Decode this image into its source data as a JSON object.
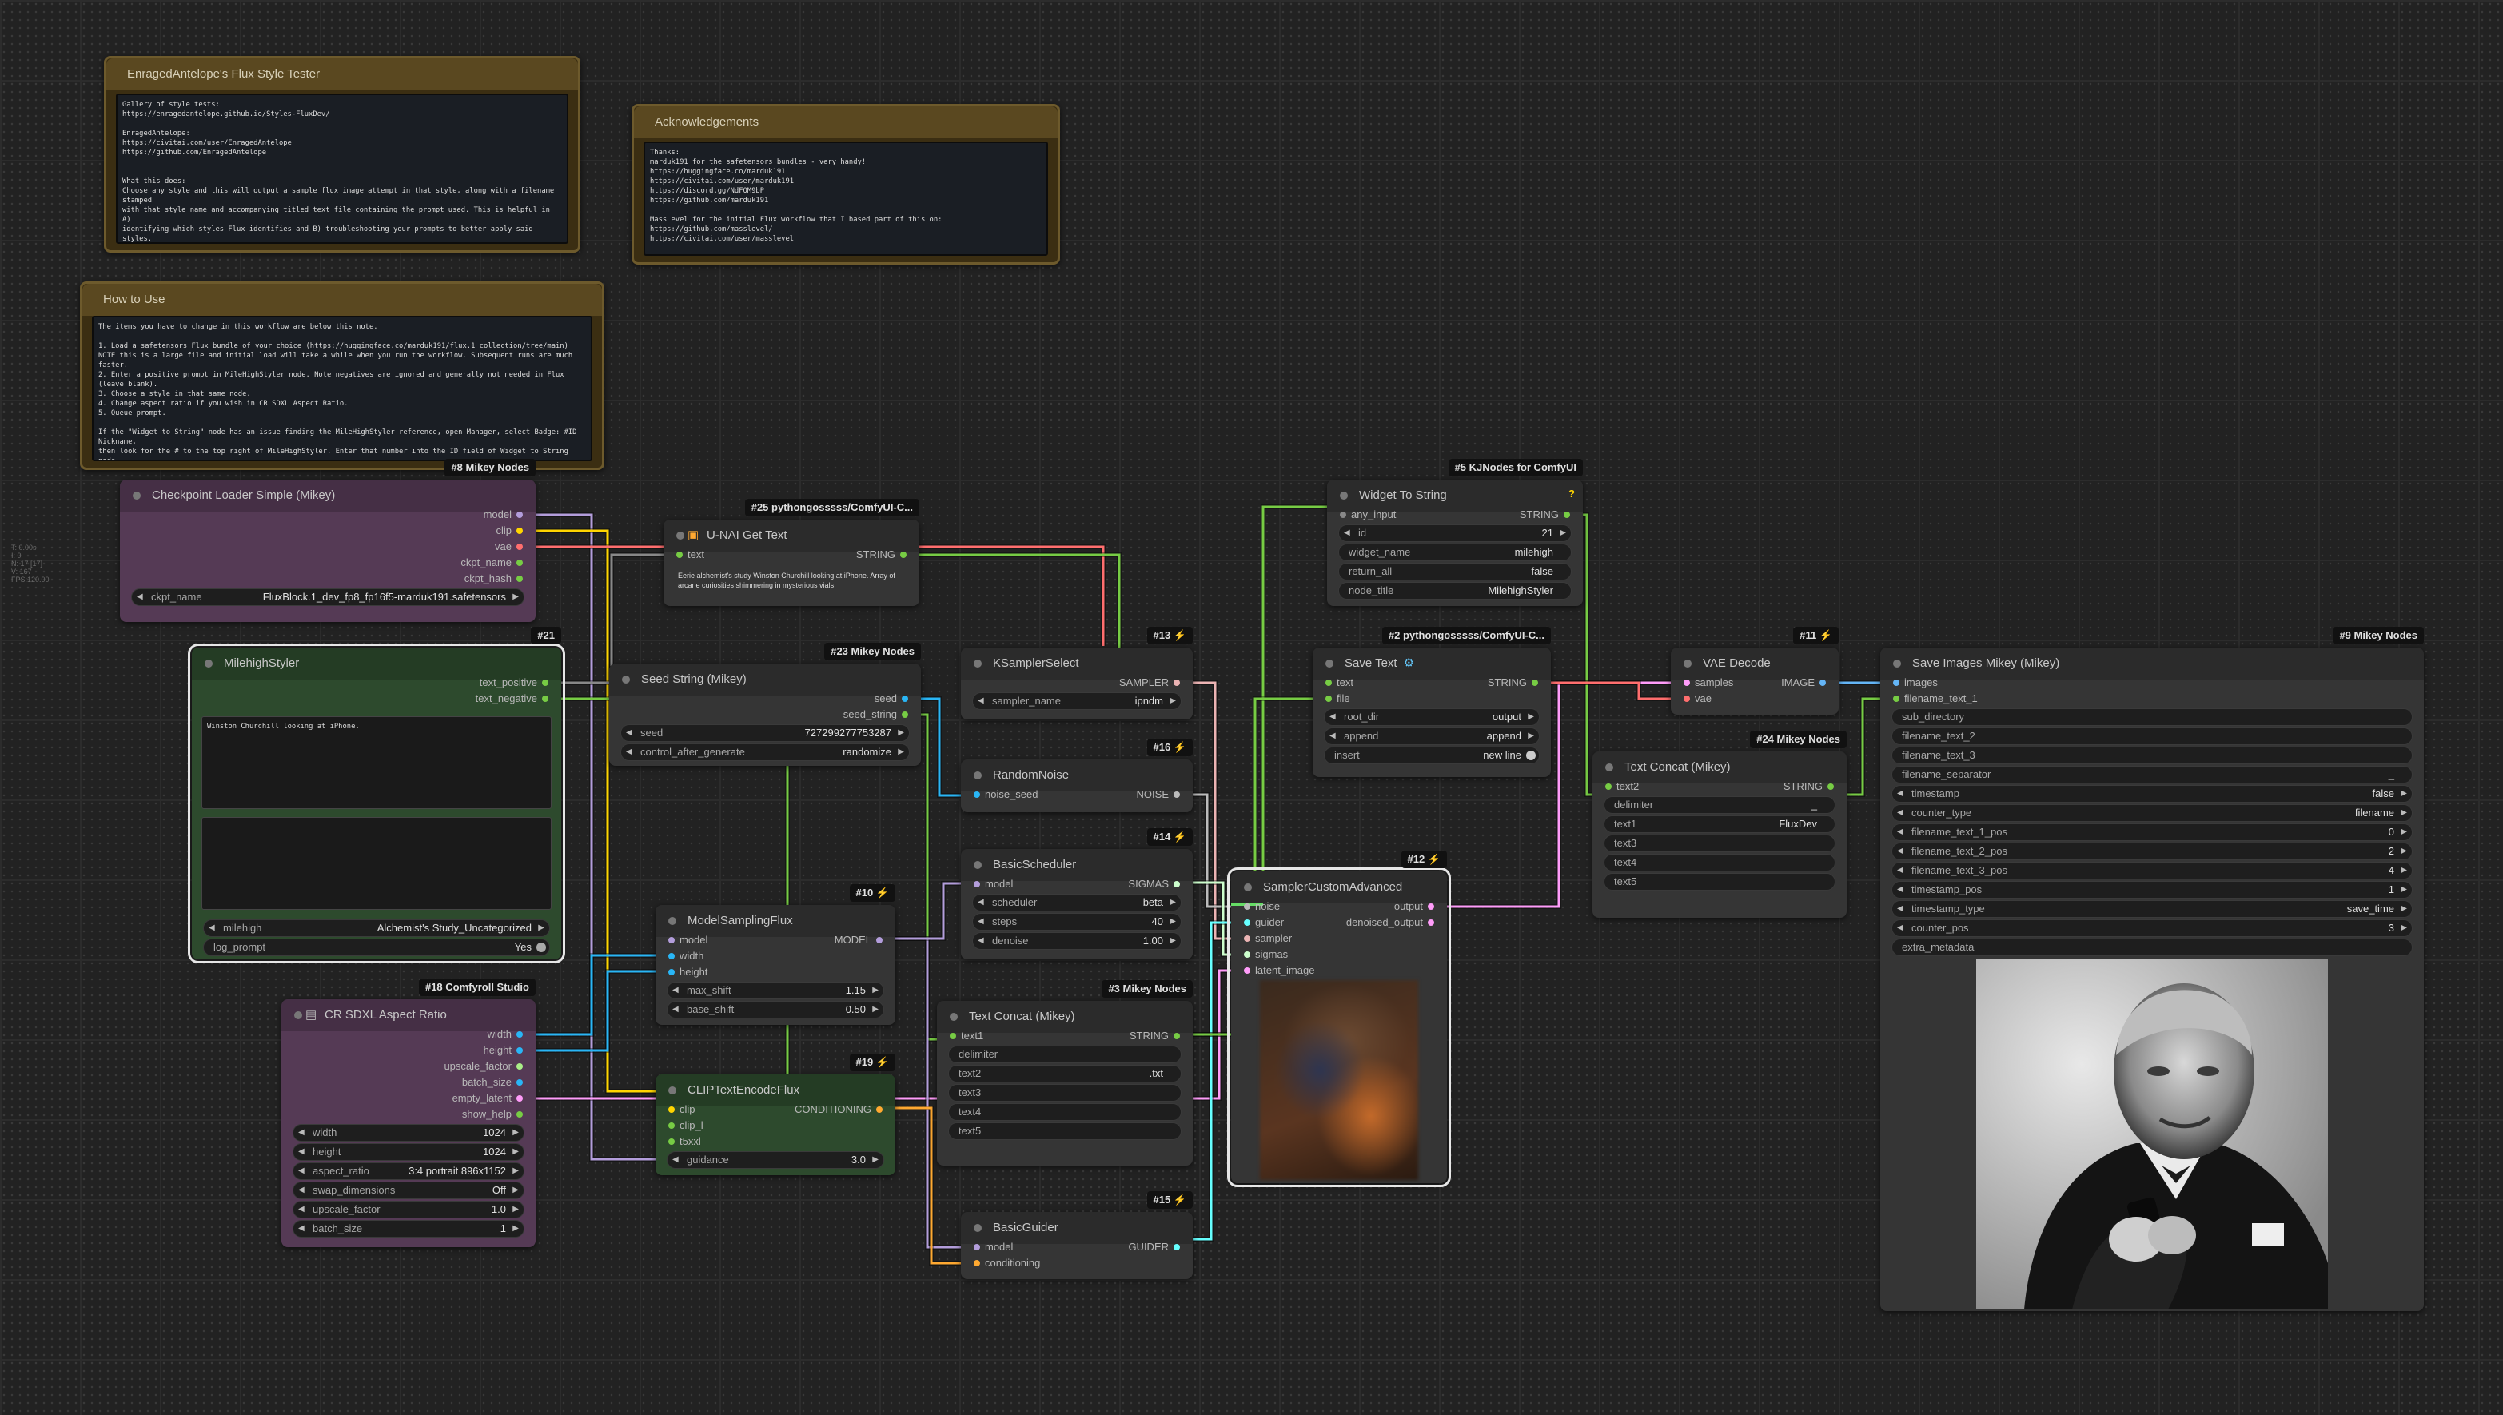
{
  "colors": {
    "model": "#b39ddb",
    "clip": "#ffd500",
    "vae": "#ff6e6e",
    "string": "#77cc44",
    "int": "#29b6f6",
    "float": "#aaee88",
    "conditioning": "#ffa931",
    "latent": "#ff9cf9",
    "image": "#64b5f6",
    "noise": "#bbbbbb",
    "sampler": "#ecb4b4",
    "sigmas": "#cdffcd",
    "guider": "#66ffff",
    "grey": "#888888"
  },
  "status_text": "T: 0.00s\nI: 0\nN: 17 [17]\nV: 167\nFPS:120.00",
  "n1": {
    "title": "EnragedAntelope's Flux Style Tester",
    "text": "Gallery of style tests:\nhttps://enragedantelope.github.io/Styles-FluxDev/\n\nEnragedAntelope:\nhttps://civitai.com/user/EnragedAntelope\nhttps://github.com/EnragedAntelope\n\n\nWhat this does:\nChoose any style and this will output a sample flux image attempt in that style, along with a filename stamped\nwith that style name and accompanying titled text file containing the prompt used. This is helpful in A)\nidentifying which styles Flux identifies and B) troubleshooting your prompts to better apply said styles."
  },
  "n2": {
    "title": "Acknowledgements",
    "text": "Thanks:\nmarduk191 for the safetensors bundles - very handy!\nhttps://huggingface.co/marduk191\nhttps://civitai.com/user/marduk191\nhttps://discord.gg/NdFQM9bP\nhttps://github.com/marduk191\n\nMassLevel for the initial Flux workflow that I based part of this on:\nhttps://github.com/masslevel/\nhttps://civitai.com/user/masslevel\n\nAs well as the Flux team, Comfy and node devs!"
  },
  "n3": {
    "title": "How to Use",
    "text": "The items you have to change in this workflow are below this note.\n\n1. Load a safetensors Flux bundle of your choice (https://huggingface.co/marduk191/flux.1_collection/tree/main)\nNOTE this is a large file and initial load will take a while when you run the workflow. Subsequent runs are much faster.\n2. Enter a positive prompt in MileHighStyler node. Note negatives are ignored and generally not needed in Flux (leave blank).\n3. Choose a style in that same node.\n4. Change aspect ratio if you wish in CR SDXL Aspect Ratio.\n5. Queue prompt.\n\nIf the \"Widget to String\" node has an issue finding the MileHighStyler reference, open Manager, select Badge: #ID Nickname,\nthen look for the # to the top right of MileHighStyler. Enter that number into the ID field of Widget to String node."
  },
  "ckpt": {
    "badge": "#8 Mikey Nodes",
    "title": "Checkpoint Loader Simple (Mikey)",
    "outputs": [
      "model",
      "clip",
      "vae",
      "ckpt_name",
      "ckpt_hash"
    ],
    "w_name": "ckpt_name",
    "w_value": "FluxBlock.1_dev_fp8_fp16f5-marduk191.safetensors"
  },
  "unai": {
    "badge": "#25 pythongosssss/ComfyUI-C...",
    "title": "U-NAI Get Text",
    "in": "text",
    "out": "STRING",
    "text": "Eerie alchemist's study Winston Churchill looking at iPhone. Array of arcane curiosities shimmering in mysterious vials"
  },
  "styler": {
    "badge": "#21",
    "title": "MilehighStyler",
    "outputs": [
      "text_positive",
      "text_negative"
    ],
    "pos": "Winston Churchill looking at iPhone.",
    "w1_name": "milehigh",
    "w1_value": "Alchemist's Study_Uncategorized",
    "w2_name": "log_prompt",
    "w2_value": "Yes"
  },
  "seed": {
    "badge": "#23 Mikey Nodes",
    "title": "Seed String (Mikey)",
    "outputs": [
      "seed",
      "seed_string"
    ],
    "w1_name": "seed",
    "w1_value": "727299277753287",
    "w2_name": "control_after_generate",
    "w2_value": "randomize"
  },
  "ksel": {
    "badge": "#13 ⚡",
    "title": "KSamplerSelect",
    "out": "SAMPLER",
    "w_name": "sampler_name",
    "w_value": "ipndm"
  },
  "noise": {
    "badge": "#16 ⚡",
    "title": "RandomNoise",
    "in": "noise_seed",
    "out": "NOISE"
  },
  "sched": {
    "badge": "#14 ⚡",
    "title": "BasicScheduler",
    "in": "model",
    "out": "SIGMAS",
    "w": [
      {
        "n": "scheduler",
        "v": "beta"
      },
      {
        "n": "steps",
        "v": "40"
      },
      {
        "n": "denoise",
        "v": "1.00"
      }
    ]
  },
  "msf": {
    "badge": "#10 ⚡",
    "title": "ModelSamplingFlux",
    "inputs": [
      "model",
      "width",
      "height"
    ],
    "out": "MODEL",
    "w": [
      {
        "n": "max_shift",
        "v": "1.15"
      },
      {
        "n": "base_shift",
        "v": "0.50"
      }
    ]
  },
  "cr": {
    "badge": "#18 Comfyroll Studio",
    "title": "CR SDXL Aspect Ratio",
    "outputs": [
      "width",
      "height",
      "upscale_factor",
      "batch_size",
      "empty_latent",
      "show_help"
    ],
    "w": [
      {
        "n": "width",
        "v": "1024"
      },
      {
        "n": "height",
        "v": "1024"
      },
      {
        "n": "aspect_ratio",
        "v": "3:4 portrait 896x1152"
      },
      {
        "n": "swap_dimensions",
        "v": "Off"
      },
      {
        "n": "upscale_factor",
        "v": "1.0"
      },
      {
        "n": "batch_size",
        "v": "1"
      }
    ]
  },
  "clipt": {
    "badge": "#19 ⚡",
    "title": "CLIPTextEncodeFlux",
    "inputs": [
      "clip",
      "clip_l",
      "t5xxl"
    ],
    "out": "CONDITIONING",
    "w_name": "guidance",
    "w_value": "3.0"
  },
  "tc3": {
    "badge": "#3 Mikey Nodes",
    "title": "Text Concat (Mikey)",
    "in": "text1",
    "out": "STRING",
    "rows": [
      "delimiter",
      "text2",
      "text3",
      "text4",
      "text5"
    ],
    "row2val": ".txt"
  },
  "bg": {
    "badge": "#15 ⚡",
    "title": "BasicGuider",
    "inputs": [
      "model",
      "conditioning"
    ],
    "out": "GUIDER"
  },
  "wts": {
    "badge": "#5 KJNodes for ComfyUI",
    "title": "Widget To String",
    "in": "any_input",
    "out": "STRING",
    "w": [
      {
        "n": "id",
        "v": "21"
      },
      {
        "n": "widget_name",
        "v": "milehigh"
      },
      {
        "n": "return_all",
        "v": "false"
      },
      {
        "n": "node_title",
        "v": "MilehighStyler"
      }
    ]
  },
  "save": {
    "badge": "#2 pythongosssss/ComfyUI-C...",
    "title": "Save Text",
    "inputs": [
      "text",
      "file"
    ],
    "out": "STRING",
    "w": [
      {
        "n": "root_dir",
        "v": "output"
      },
      {
        "n": "append",
        "v": "append"
      },
      {
        "n": "insert",
        "v": "new line"
      }
    ]
  },
  "sca": {
    "badge": "#12 ⚡",
    "title": "SamplerCustomAdvanced",
    "inputs": [
      "noise",
      "guider",
      "sampler",
      "sigmas",
      "latent_image"
    ],
    "outputs": [
      "output",
      "denoised_output"
    ]
  },
  "vae": {
    "badge": "#11 ⚡",
    "title": "VAE Decode",
    "inputs": [
      "samples",
      "vae"
    ],
    "out": "IMAGE"
  },
  "tc24": {
    "badge": "#24 Mikey Nodes",
    "title": "Text Concat (Mikey)",
    "in": "text2",
    "out": "STRING",
    "rows": [
      "delimiter",
      "text1",
      "text3",
      "text4",
      "text5"
    ],
    "row0val": "_",
    "row1val": "FluxDev"
  },
  "sim": {
    "badge": "#9 Mikey Nodes",
    "title": "Save Images Mikey (Mikey)",
    "inputs": [
      "images",
      "filename_text_1"
    ],
    "rows": [
      {
        "n": "sub_directory",
        "v": ""
      },
      {
        "n": "filename_text_2",
        "v": ""
      },
      {
        "n": "filename_text_3",
        "v": ""
      },
      {
        "n": "filename_separator",
        "v": "_"
      }
    ],
    "w": [
      {
        "n": "timestamp",
        "v": "false"
      },
      {
        "n": "counter_type",
        "v": "filename"
      },
      {
        "n": "filename_text_1_pos",
        "v": "0"
      },
      {
        "n": "filename_text_2_pos",
        "v": "2"
      },
      {
        "n": "filename_text_3_pos",
        "v": "4"
      },
      {
        "n": "timestamp_pos",
        "v": "1"
      },
      {
        "n": "timestamp_type",
        "v": "save_time"
      },
      {
        "n": "counter_pos",
        "v": "3"
      }
    ],
    "extra": "extra_metadata"
  }
}
